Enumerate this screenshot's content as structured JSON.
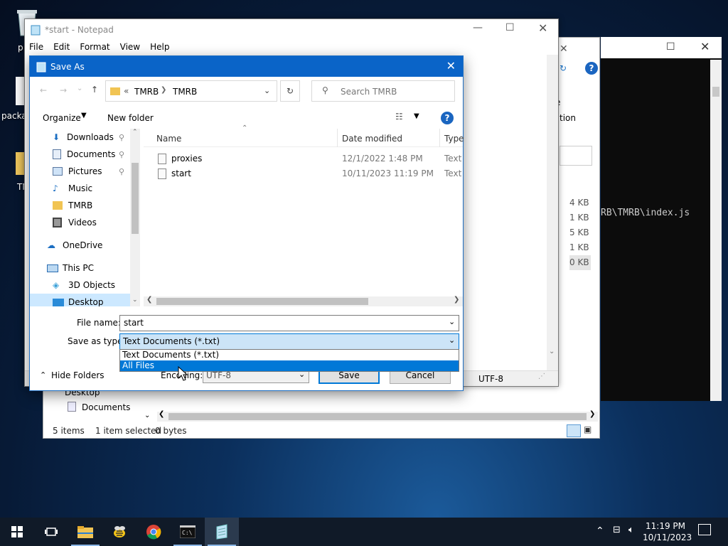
{
  "desktop": {
    "icons": [
      {
        "label": "p",
        "icon": "recycle-bin-icon"
      },
      {
        "label": "packa",
        "icon": "document-icon"
      },
      {
        "label": "TM",
        "icon": "folder-icon"
      }
    ]
  },
  "console": {
    "path_fragment": "RB\\TMRB\\index.js"
  },
  "explorer": {
    "partial_ribbon": [
      "e",
      "tion"
    ],
    "sizes": [
      "4 KB",
      "1 KB",
      "5 KB",
      "1 KB",
      "0 KB"
    ],
    "nav_partial": [
      "Desktop",
      "Documents"
    ],
    "status": {
      "items": "5 items",
      "selected": "1 item selected",
      "bytes": "0 bytes"
    }
  },
  "notepad": {
    "title": "*start - Notepad",
    "menu": [
      "File",
      "Edit",
      "Format",
      "View",
      "Help"
    ],
    "status_encoding": "UTF-8"
  },
  "dialog": {
    "title": "Save As",
    "breadcrumb": {
      "prefix": "«",
      "parts": [
        "TMRB",
        "TMRB"
      ]
    },
    "search_placeholder": "Search TMRB",
    "toolbar": {
      "organize": "Organize",
      "new_folder": "New folder"
    },
    "nav": [
      {
        "label": "Downloads",
        "icon": "download-arrow-icon",
        "pinned": true,
        "indent": 1
      },
      {
        "label": "Documents",
        "icon": "documents-icon",
        "pinned": true,
        "indent": 1
      },
      {
        "label": "Pictures",
        "icon": "pictures-icon",
        "pinned": true,
        "indent": 1
      },
      {
        "label": "Music",
        "icon": "music-note-icon",
        "pinned": false,
        "indent": 1
      },
      {
        "label": "TMRB",
        "icon": "folder-icon",
        "pinned": false,
        "indent": 1
      },
      {
        "label": "Videos",
        "icon": "videos-icon",
        "pinned": false,
        "indent": 1
      },
      {
        "label": "OneDrive",
        "icon": "cloud-icon",
        "pinned": false,
        "indent": 0
      },
      {
        "label": "This PC",
        "icon": "computer-icon",
        "pinned": false,
        "indent": 0
      },
      {
        "label": "3D Objects",
        "icon": "cube-icon",
        "pinned": false,
        "indent": 1
      },
      {
        "label": "Desktop",
        "icon": "desktop-icon",
        "pinned": false,
        "indent": 1,
        "selected": true
      }
    ],
    "columns": {
      "name": "Name",
      "date": "Date modified",
      "type": "Type"
    },
    "files": [
      {
        "name": "proxies",
        "date": "12/1/2022 1:48 PM",
        "type": "Text D"
      },
      {
        "name": "start",
        "date": "10/11/2023 11:19 PM",
        "type": "Text D"
      }
    ],
    "filename_label": "File name:",
    "filename_value": "start",
    "savetype_label": "Save as type:",
    "savetype_value": "Text Documents (*.txt)",
    "savetype_options": [
      "Text Documents (*.txt)",
      "All Files"
    ],
    "highlighted_option": 1,
    "hide_folders": "Hide Folders",
    "encoding_label": "Encoding:",
    "encoding_value": "UTF-8",
    "save": "Save",
    "cancel": "Cancel"
  },
  "taskbar": {
    "apps": [
      "start-icon",
      "task-view-icon",
      "file-explorer-icon",
      "bee-app-icon",
      "chrome-icon",
      "terminal-icon",
      "notepad-icon"
    ],
    "time": "11:19 PM",
    "date": "10/11/2023"
  }
}
